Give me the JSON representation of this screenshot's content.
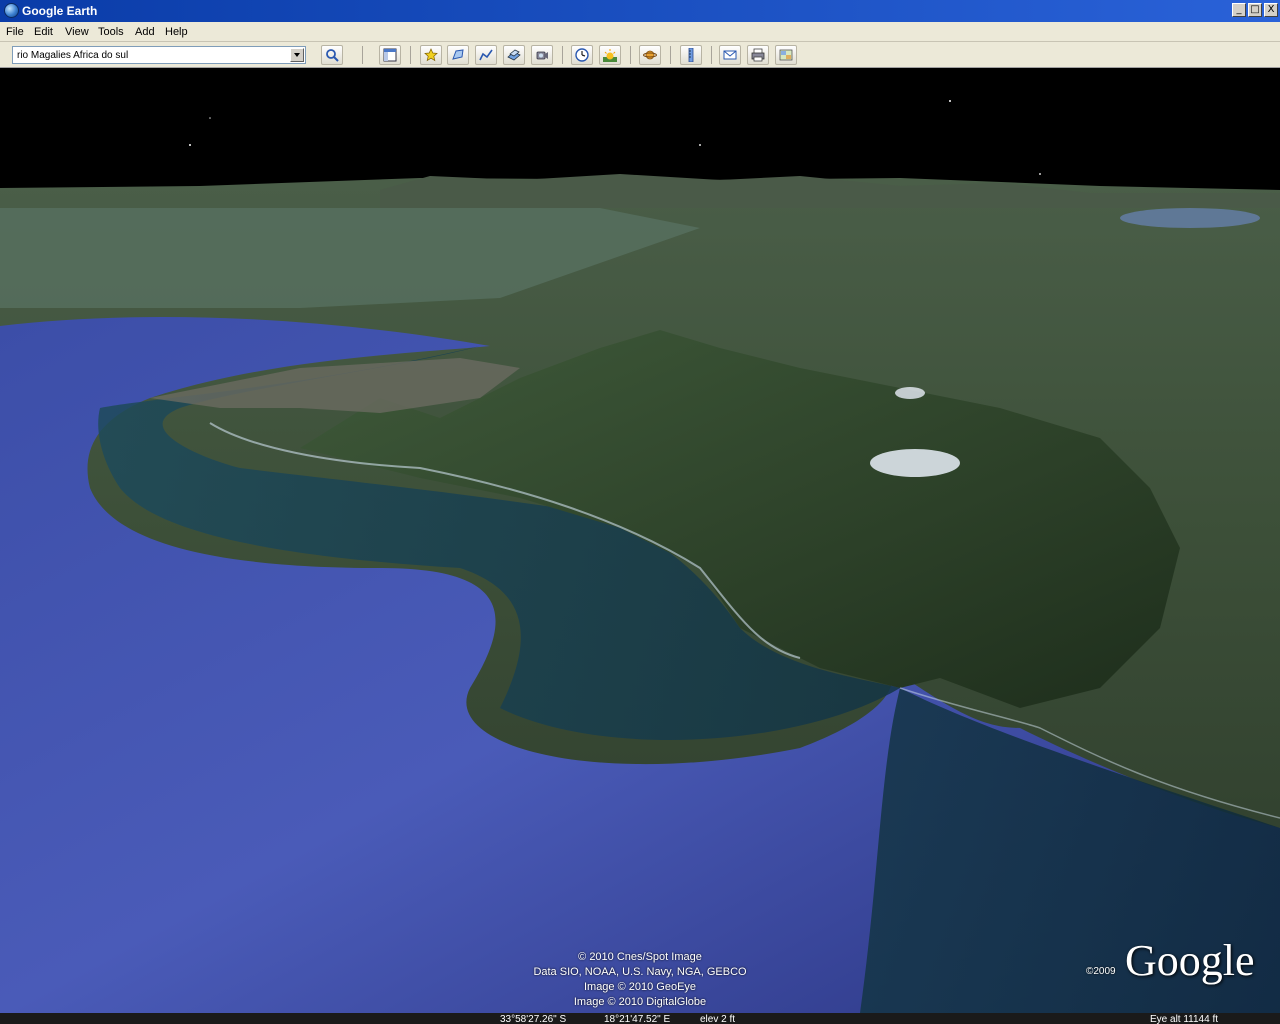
{
  "window": {
    "title": "Google Earth",
    "buttons": {
      "minimize": "_",
      "maximize": "□",
      "close": "X"
    }
  },
  "menu": {
    "items": [
      "File",
      "Edit",
      "View",
      "Tools",
      "Add",
      "Help"
    ]
  },
  "search": {
    "value": "rio Magalies Africa do sul"
  },
  "toolbar": {
    "icons": [
      "search-icon",
      "sidebar-icon",
      "placemark-icon",
      "polygon-icon",
      "path-icon",
      "overlay-icon",
      "tour-icon",
      "historical-imagery-icon",
      "sunlight-icon",
      "planets-icon",
      "ruler-icon",
      "email-icon",
      "print-icon",
      "maps-icon"
    ]
  },
  "map": {
    "credits": [
      "© 2010 Cnes/Spot Image",
      "Data SIO, NOAA, U.S. Navy, NGA, GEBCO",
      "Image © 2010 GeoEye",
      "Image © 2010 DigitalGlobe"
    ],
    "copyright_year": "©2009",
    "logo": "Google"
  },
  "status": {
    "latitude": "33°58'27.26\" S",
    "longitude": "18°21'47.52\" E",
    "elevation": "elev    2 ft",
    "eye_alt": "Eye alt   11144 ft"
  },
  "colors": {
    "titlebar": "#0a3ca8",
    "chrome": "#ece9d8",
    "ocean": "#3a4aa0",
    "land": "#3f5a3c"
  }
}
